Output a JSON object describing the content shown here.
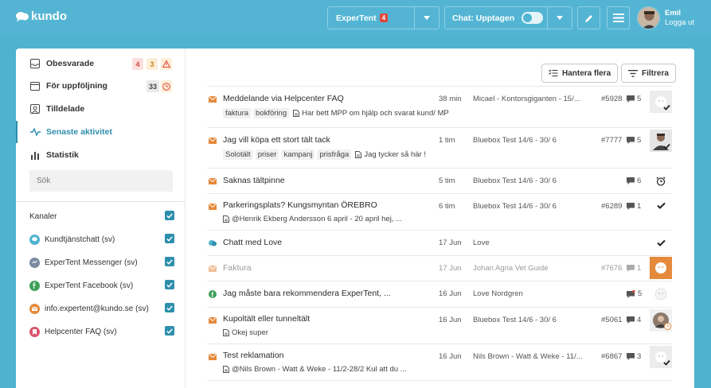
{
  "app": {
    "logo_text": "kundo"
  },
  "topbar": {
    "brand": "ExperTent",
    "brand_badge": "4",
    "chat_label": "Chat: Upptagen",
    "user_name": "Emil",
    "logout": "Logga ut"
  },
  "nav": [
    {
      "label": "Obesvarade",
      "icon": "inbox-icon",
      "counts": [
        "4",
        "3"
      ]
    },
    {
      "label": "För uppföljning",
      "icon": "calendar-icon",
      "counts": [
        "33"
      ]
    },
    {
      "label": "Tilldelade",
      "icon": "user-badge-icon"
    },
    {
      "label": "Senaste aktivitet",
      "icon": "activity-icon",
      "active": true
    },
    {
      "label": "Statistik",
      "icon": "bar-chart-icon"
    }
  ],
  "search": {
    "placeholder": "Sök"
  },
  "channels": {
    "header": "Kanaler",
    "items": [
      {
        "label": "Kundtjänstchatt (sv)",
        "color": "#4fb3d0"
      },
      {
        "label": "ExperTent Messenger (sv)",
        "color": "#7a8aa0"
      },
      {
        "label": "ExperTent Facebook (sv)",
        "color": "#3ea05a"
      },
      {
        "label": "info.expertent@kundo.se (sv)",
        "color": "#e58a3c"
      },
      {
        "label": "Helpcenter FAQ (sv)",
        "color": "#d9536a"
      }
    ]
  },
  "toolbar": {
    "manage": "Hantera flera",
    "filter": "Filtrera"
  },
  "colors": {
    "accent": "#53b5d3",
    "active": "#2e8fad",
    "mail": "#e58a3c",
    "facebook": "#3ea05a",
    "orange_avatar": "#e58a3c"
  },
  "rows": [
    {
      "subject": "Meddelande via Helpcenter FAQ",
      "time": "38 min",
      "author": "Micael - Kontorsgiganten - 15/...",
      "id": "#5928",
      "comments": "5",
      "tags": [
        "faktura",
        "bokföring"
      ],
      "snippet": "Har bett MPP om hjälp och svarat kund/ MP"
    },
    {
      "subject": "Jag vill köpa ett stort tält tack",
      "time": "1 tim",
      "author": "Bluebox Test 14/6 - 30/ 6",
      "id": "#7777",
      "comments": "5",
      "tags": [
        "Solotält",
        "priser",
        "kampanj",
        "prisfråga"
      ],
      "snippet": "Jag tycker så här !"
    },
    {
      "subject": "Saknas tältpinne",
      "time": "5 tim",
      "author": "Bluebox Test 14/6 - 30/ 6",
      "id": "",
      "comments": "6"
    },
    {
      "subject": "Parkeringsplats? Kungsmyntan ÖREBRO",
      "time": "6 tim",
      "author": "Bluebox Test 14/6 - 30/ 6",
      "id": "#6289",
      "comments": "1",
      "snippet": "@Henrik Ekberg Andersson 6 april - 20 april  hej, ..."
    },
    {
      "subject": "Chatt med Love",
      "time": "17 Jun",
      "author": "Love",
      "id": "",
      "comments": ""
    },
    {
      "subject": "Faktura",
      "time": "17 Jun",
      "author": "Johan Agria Vet Guide",
      "id": "#7676",
      "comments": "1"
    },
    {
      "subject": "Jag måste bara rekommendera ExperTent, ...",
      "time": "16 Jun",
      "author": "Love Nordgren",
      "id": "",
      "comments": "5"
    },
    {
      "subject": "Kupoltält eller tunneltält",
      "time": "16 Jun",
      "author": "Bluebox Test 14/6 - 30/ 6",
      "id": "#5061",
      "comments": "4",
      "snippet": "Okej super"
    },
    {
      "subject": "Test reklamation",
      "time": "16 Jun",
      "author": "Nils Brown - Watt & Weke - 11/...",
      "id": "#6867",
      "comments": "3",
      "snippet": "@Nils Brown - Watt & Weke - 11/2-28/2 Kul att du ..."
    }
  ]
}
